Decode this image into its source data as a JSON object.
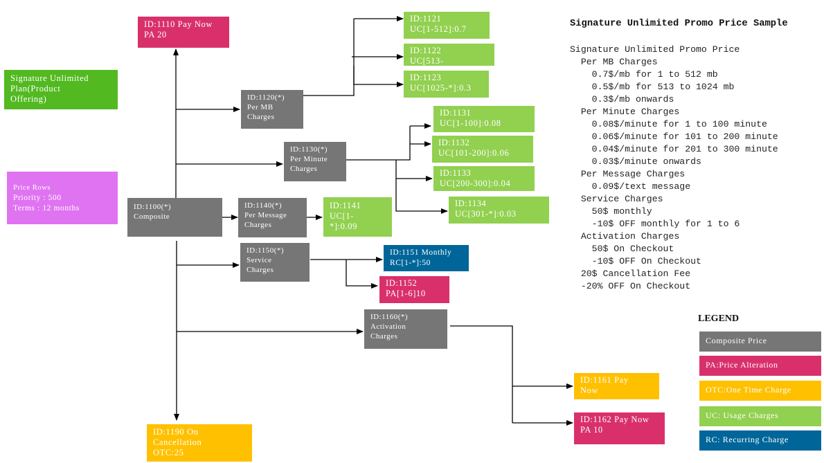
{
  "colors": {
    "composite": "#767676",
    "price_alteration": "#d9306c",
    "one_time_charge": "#ffc000",
    "usage_charge": "#92d050",
    "recurring_charge": "#006699",
    "product_offering": "#52b920",
    "price_rows": "#e073f2"
  },
  "product_offering": {
    "lines": [
      "Signature Unlimited",
      "Plan(Product",
      "Offering)"
    ]
  },
  "price_rows": {
    "lines": [
      "Price Rows",
      "Priority : 500",
      "Terms : 12 months"
    ]
  },
  "nodes": {
    "n1100": {
      "type": "composite",
      "lines": [
        "ID:1100(*)",
        "Composite"
      ]
    },
    "n1110": {
      "type": "price_alteration",
      "lines": [
        "ID:1110 Pay Now",
        "PA 20"
      ]
    },
    "n1120": {
      "type": "composite",
      "lines": [
        "ID:1120(*)",
        "Per MB",
        "Charges"
      ]
    },
    "n1121": {
      "type": "usage_charge",
      "lines": [
        "ID:1121",
        "UC[1-512]:0.7"
      ]
    },
    "n1122": {
      "type": "usage_charge",
      "lines": [
        "ID:1122",
        "UC[513-"
      ]
    },
    "n1123": {
      "type": "usage_charge",
      "lines": [
        "ID:1123",
        "UC[1025-*]:0.3"
      ]
    },
    "n1130": {
      "type": "composite",
      "lines": [
        "ID:1130(*)",
        "Per Minute",
        "Charges"
      ]
    },
    "n1131": {
      "type": "usage_charge",
      "lines": [
        "ID:1131",
        "UC[1-100]:0.08"
      ]
    },
    "n1132": {
      "type": "usage_charge",
      "lines": [
        "ID:1132",
        "UC[101-200]:0.06"
      ]
    },
    "n1133": {
      "type": "usage_charge",
      "lines": [
        "ID:1133",
        "UC[200-300]:0.04"
      ]
    },
    "n1134": {
      "type": "usage_charge",
      "lines": [
        "ID:1134",
        "UC[301-*]:0.03"
      ]
    },
    "n1140": {
      "type": "composite",
      "lines": [
        "ID:1140(*)",
        "Per Message",
        "Charges"
      ]
    },
    "n1141": {
      "type": "usage_charge",
      "lines": [
        "ID:1141",
        "UC[1-",
        "*]:0.09"
      ]
    },
    "n1150": {
      "type": "composite",
      "lines": [
        "ID:1150(*)",
        "Service",
        "Charges"
      ]
    },
    "n1151": {
      "type": "recurring_charge",
      "lines": [
        "ID:1151 Monthly",
        "RC[1-*]:50"
      ]
    },
    "n1152": {
      "type": "price_alteration",
      "lines": [
        "ID:1152",
        "PA[1-6]10"
      ]
    },
    "n1160": {
      "type": "composite",
      "lines": [
        "ID:1160(*)",
        "Activation",
        "Charges"
      ]
    },
    "n1161": {
      "type": "one_time_charge",
      "lines": [
        "ID:1161 Pay",
        "Now"
      ]
    },
    "n1162": {
      "type": "price_alteration",
      "lines": [
        "ID:1162 Pay Now",
        "PA 10"
      ]
    },
    "n1190": {
      "type": "one_time_charge",
      "lines": [
        "ID:1190 On",
        "Cancellation",
        "OTC:25"
      ]
    }
  },
  "notes": {
    "title": "Signature Unlimited Promo Price Sample",
    "lines": [
      "Signature Unlimited Promo Price",
      "  Per MB Charges",
      "    0.7$/mb for 1 to 512 mb",
      "    0.5$/mb for 513 to 1024 mb",
      "    0.3$/mb onwards",
      "  Per Minute Charges",
      "    0.08$/minute for 1 to 100 minute",
      "    0.06$/minute for 101 to 200 minute",
      "    0.04$/minute for 201 to 300 minute",
      "    0.03$/minute onwards",
      "  Per Message Charges",
      "    0.09$/text message",
      "  Service Charges",
      "    50$ monthly",
      "    -10$ OFF monthly for 1 to 6",
      "  Activation Charges",
      "    50$ On Checkout",
      "    -10$ OFF On Checkout",
      "  20$ Cancellation Fee",
      "  -20% OFF On Checkout"
    ]
  },
  "legend": {
    "title": "LEGEND",
    "items": [
      {
        "label": "Composite Price",
        "color": "#767676"
      },
      {
        "label": "PA:Price Alteration",
        "color": "#d9306c"
      },
      {
        "label": "OTC:One Time Charge",
        "color": "#ffc000"
      },
      {
        "label": "UC: Usage Charges",
        "color": "#92d050"
      },
      {
        "label": "RC: Recurring Charge",
        "color": "#006699"
      }
    ]
  }
}
